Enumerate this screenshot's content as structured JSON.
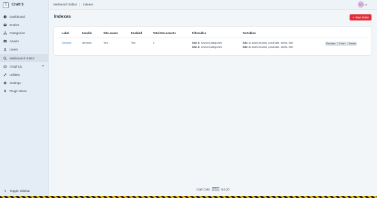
{
  "site": {
    "initial": "C",
    "name": "Craft 5"
  },
  "nav": [
    {
      "icon": "gauge-icon",
      "label": "Dashboard"
    },
    {
      "icon": "newspaper-icon",
      "label": "Entries"
    },
    {
      "icon": "sitemap-icon",
      "label": "Categories"
    },
    {
      "icon": "image-icon",
      "label": "Assets"
    },
    {
      "icon": "user-icon",
      "label": "Users"
    },
    {
      "icon": "search-icon",
      "label": "Meilisearch Editor",
      "active": true
    },
    {
      "icon": "graphql-icon",
      "label": "GraphQL",
      "expandable": true
    },
    {
      "icon": "wrench-icon",
      "label": "Utilities"
    },
    {
      "icon": "gear-icon",
      "label": "Settings"
    },
    {
      "icon": "plug-icon",
      "label": "Plugin Store"
    }
  ],
  "toggle_sidebar": "Toggle sidebar",
  "breadcrumbs": [
    "Meilisearch Editor",
    "Indexes"
  ],
  "avatar_initials": "SD",
  "page_title": "Indexes",
  "new_button": "New index",
  "table": {
    "headers": [
      "Label",
      "Handle",
      "Site-aware",
      "Enabled",
      "Total Documents",
      "Filterables",
      "Sortables",
      ""
    ],
    "rows": [
      {
        "label": "Devices",
        "handle": "devices",
        "site_aware": "Yes",
        "enabled": "Yes",
        "total_documents": "4",
        "filterables": [
          {
            "site": "Site 1:",
            "value": "deviceCategories"
          },
          {
            "site": "Site 2:",
            "value": "deviceCategories"
          }
        ],
        "sortables": [
          {
            "site": "Site 1:",
            "value": "dateCreated, postDate, siteId, title"
          },
          {
            "site": "Site 2:",
            "value": "dateCreated, postDate, siteId, title"
          }
        ],
        "actions": [
          "Reindex",
          "Flush",
          "Delete"
        ]
      }
    ]
  },
  "footer": {
    "product": "Craft CMS",
    "edition": "PRO",
    "version": "5.6.20"
  },
  "colors": {
    "sidebar_bg": "#e4edf6",
    "accent": "#e12d39",
    "link": "#1f6dd1"
  }
}
